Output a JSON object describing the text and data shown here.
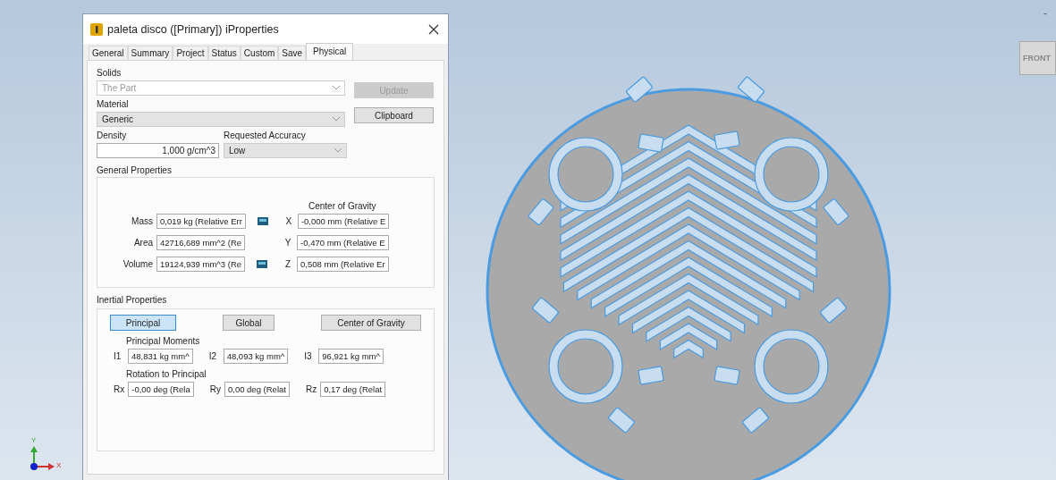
{
  "window": {
    "title": "paleta disco ([Primary]) iProperties"
  },
  "tabs": [
    {
      "label": "General",
      "selected": false
    },
    {
      "label": "Summary",
      "selected": false
    },
    {
      "label": "Project",
      "selected": false
    },
    {
      "label": "Status",
      "selected": false
    },
    {
      "label": "Custom",
      "selected": false
    },
    {
      "label": "Save",
      "selected": false
    },
    {
      "label": "Physical",
      "selected": true
    }
  ],
  "solids": {
    "label": "Solids",
    "value": "The Part",
    "disabled": true
  },
  "update_button": {
    "label": "Update",
    "disabled": true
  },
  "clipboard_button": {
    "label": "Clipboard",
    "disabled": false
  },
  "material": {
    "label": "Material",
    "value": "Generic"
  },
  "density": {
    "label": "Density",
    "value": "1,000 g/cm^3"
  },
  "accuracy": {
    "label": "Requested Accuracy",
    "value": "Low"
  },
  "general_properties": {
    "title": "General Properties",
    "cog_heading": "Center of Gravity",
    "rows": [
      {
        "label": "Mass",
        "value": "0,019 kg (Relative Err",
        "has_icon": true,
        "axis": "X",
        "cog": "-0,000 mm (Relative E"
      },
      {
        "label": "Area",
        "value": "42716,689 mm^2 (Re",
        "has_icon": false,
        "axis": "Y",
        "cog": "-0,470 mm (Relative E"
      },
      {
        "label": "Volume",
        "value": "19124,939 mm^3 (Re",
        "has_icon": true,
        "axis": "Z",
        "cog": "0,508 mm (Relative Er"
      }
    ]
  },
  "inertial_properties": {
    "title": "Inertial Properties",
    "modes": [
      {
        "label": "Principal",
        "selected": true
      },
      {
        "label": "Global",
        "selected": false
      },
      {
        "label": "Center of Gravity",
        "selected": false
      }
    ],
    "moments_heading": "Principal Moments",
    "moments": [
      {
        "label": "I1",
        "value": "48,831 kg mm^"
      },
      {
        "label": "I2",
        "value": "48,093 kg mm^"
      },
      {
        "label": "I3",
        "value": "96,921 kg mm^"
      }
    ],
    "rotation_heading": "Rotation to Principal",
    "rotations": [
      {
        "label": "Rx",
        "value": "-0,00 deg (Rela"
      },
      {
        "label": "Ry",
        "value": "0,00 deg (Relat"
      },
      {
        "label": "Rz",
        "value": "0,17 deg (Relat"
      }
    ]
  },
  "viewport": {
    "view_cube": "FRONT",
    "minimize": "-",
    "axis_x": "X",
    "axis_y": "Y"
  }
}
